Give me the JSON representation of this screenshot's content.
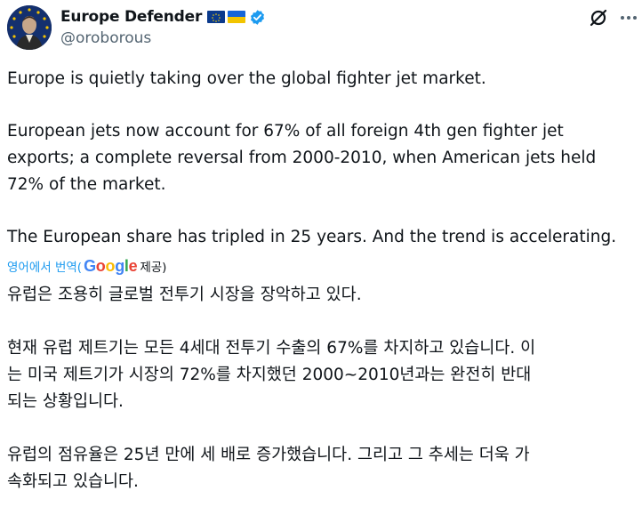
{
  "author": {
    "display_name": "Europe Defender",
    "handle": "@oroborous",
    "flags": [
      "eu-flag",
      "ukraine-flag"
    ],
    "verified": true
  },
  "colors": {
    "link": "#1d9bf0",
    "secondary_text": "#536471",
    "verified_badge": "#1d9bf0"
  },
  "tweet": {
    "paragraphs": [
      [
        "Europe is quietly taking over the global fighter jet market."
      ],
      [
        "European jets now account for 67% of all foreign 4th gen fighter jet",
        "exports; a complete reversal from 2000-2010, when American jets held",
        "72% of the market."
      ],
      [
        "The European share has tripled in 25 years. And the trend is accelerating."
      ]
    ]
  },
  "translation": {
    "link_label": "영어에서 번역(",
    "provider": "Google",
    "provider_suffix": " 제공)",
    "paragraphs": [
      [
        "유럽은 조용히 글로벌 전투기 시장을 장악하고 있다."
      ],
      [
        "현재 유럽 제트기는 모든 4세대 전투기 수출의 67%를 차지하고 있습니다. 이",
        "는 미국 제트기가 시장의 72%를 차지했던 2000~2010년과는 완전히 반대",
        "되는 상황입니다."
      ],
      [
        "유럽의 점유율은 25년 만에 세 배로 증가했습니다. 그리고 그 추세는 더욱 가",
        "속화되고 있습니다."
      ]
    ]
  },
  "icons": {
    "grok": "grok-icon",
    "more": "more-options-icon"
  }
}
